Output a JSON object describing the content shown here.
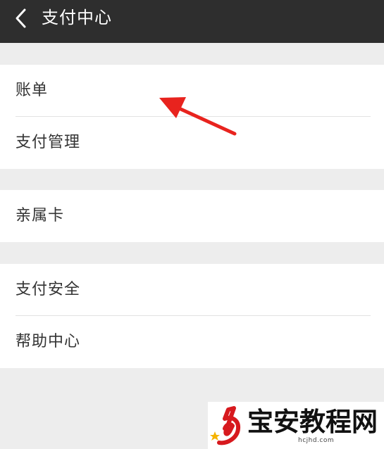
{
  "header": {
    "title": "支付中心",
    "back_icon": "chevron-left-icon"
  },
  "groups": [
    {
      "items": [
        {
          "label": "账单"
        },
        {
          "label": "支付管理"
        }
      ]
    },
    {
      "items": [
        {
          "label": "亲属卡"
        }
      ]
    },
    {
      "items": [
        {
          "label": "支付安全"
        },
        {
          "label": "帮助中心"
        }
      ]
    }
  ],
  "annotation": {
    "arrow_color": "#e8231e"
  },
  "watermark": {
    "site_name": "宝安教程网",
    "url": "hcjhd.com"
  },
  "colors": {
    "header_bg": "#2e2e2e",
    "page_bg": "#ededed",
    "card_bg": "#ffffff",
    "text": "#333333"
  }
}
